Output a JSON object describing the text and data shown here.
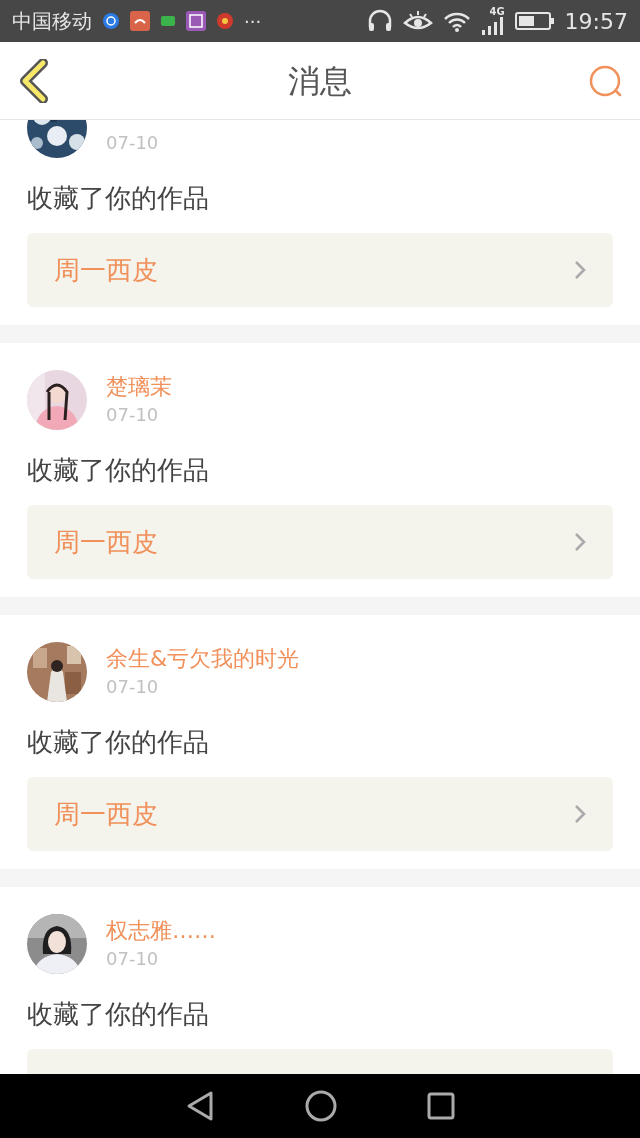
{
  "status_bar": {
    "carrier": "中国移动",
    "more": "···",
    "network": "4G",
    "time": "19:57"
  },
  "header": {
    "title": "消息"
  },
  "messages": [
    {
      "date": "07-10",
      "action": "收藏了你的作品",
      "work": "周一西皮"
    },
    {
      "name": "楚璃茉",
      "date": "07-10",
      "action": "收藏了你的作品",
      "work": "周一西皮"
    },
    {
      "name": "余生&亏欠我的时光",
      "date": "07-10",
      "action": "收藏了你的作品",
      "work": "周一西皮"
    },
    {
      "name": "权志雅……",
      "date": "07-10",
      "action": "收藏了你的作品"
    }
  ]
}
